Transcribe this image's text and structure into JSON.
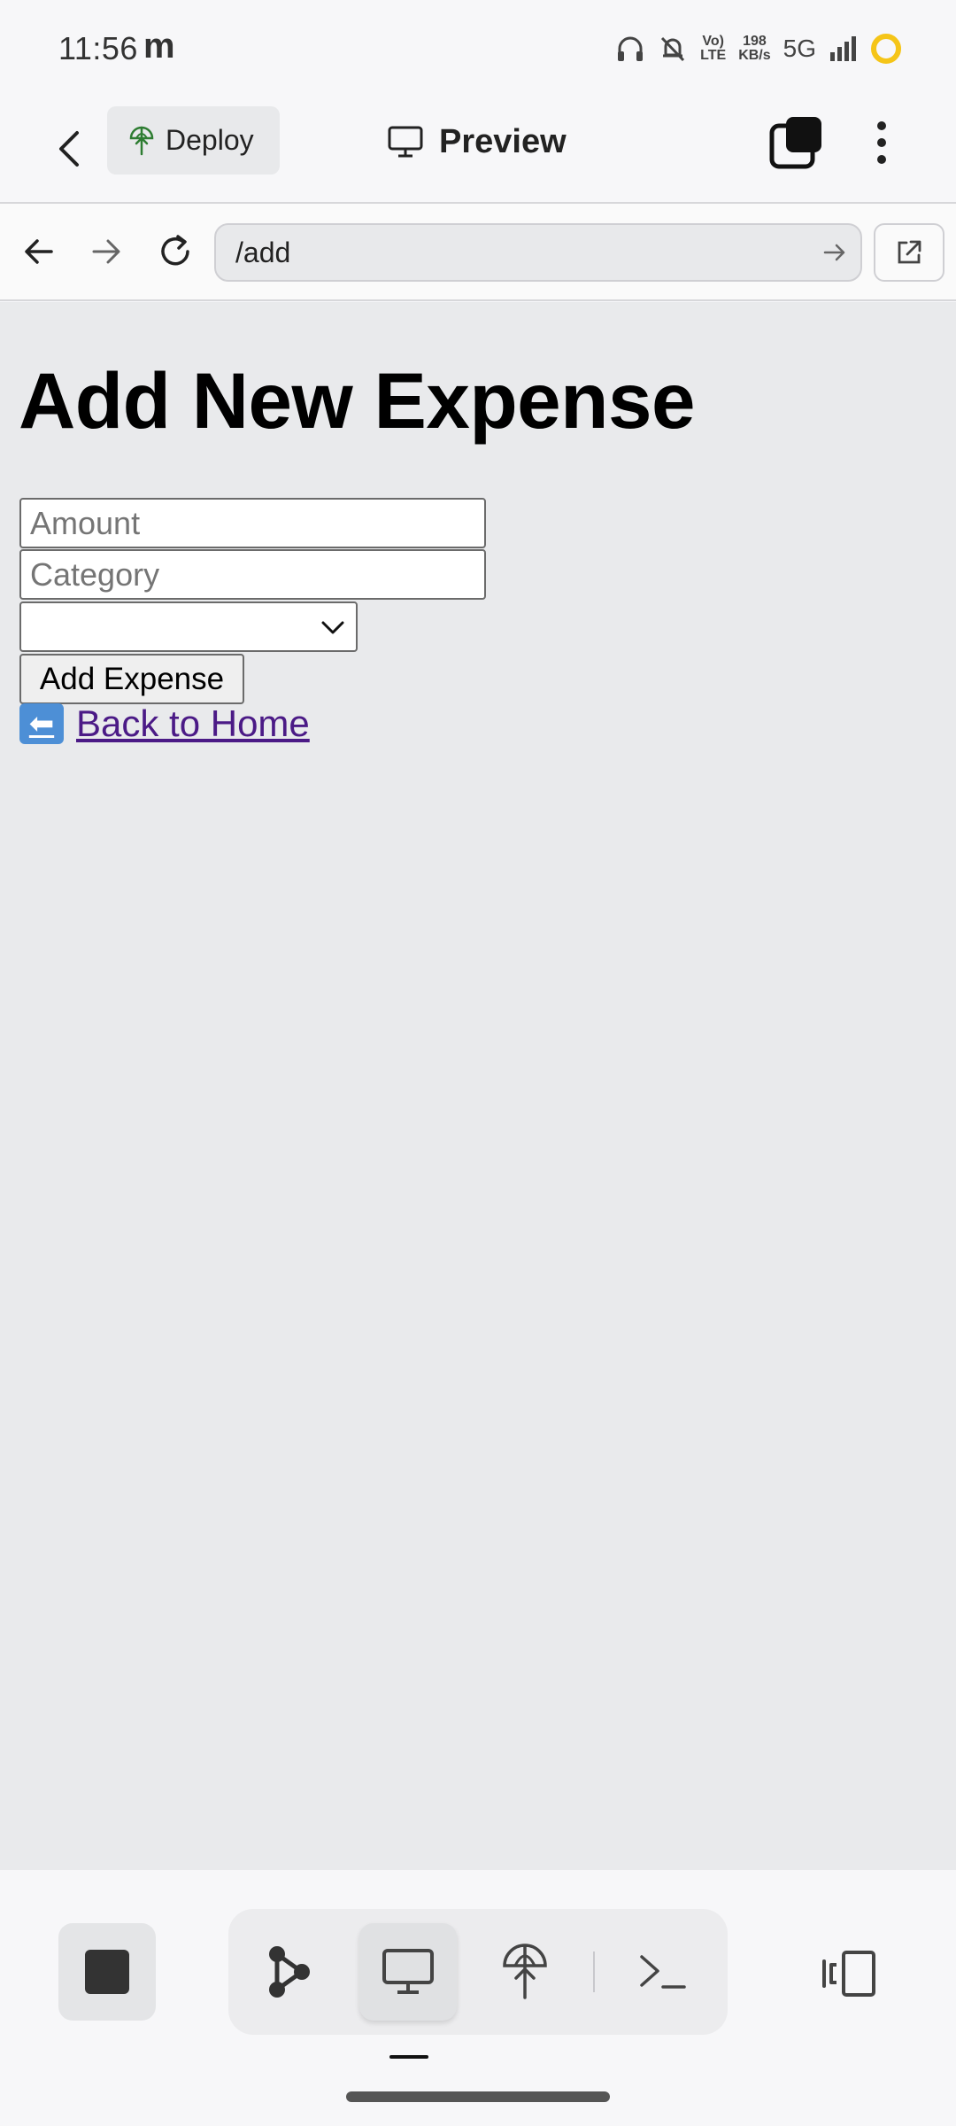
{
  "status_bar": {
    "time": "11:56",
    "carrier_glyph": "m",
    "volte_top": "Vo)",
    "volte_bottom": "LTE",
    "speed_value": "198",
    "speed_unit": "KB/s",
    "network": "5G",
    "icons": [
      "headphones-icon",
      "bell-off-icon",
      "volte-icon",
      "signal-icon",
      "battery-ring-icon"
    ]
  },
  "app_bar": {
    "deploy_label": "Deploy",
    "preview_label": "Preview",
    "icons": [
      "back-arrow-icon",
      "deploy-icon",
      "monitor-icon",
      "windows-icon",
      "more-vert-icon"
    ]
  },
  "url_bar": {
    "url": "/add",
    "icons": [
      "nav-back-icon",
      "nav-forward-icon",
      "reload-icon",
      "go-arrow-icon",
      "open-external-icon"
    ]
  },
  "page": {
    "title": "Add New Expense",
    "amount_placeholder": "Amount",
    "category_placeholder": "Category",
    "select_value": "",
    "submit_label": "Add Expense",
    "back_link_emoji": "⬅",
    "back_link_label": "Back to Home"
  },
  "bottom_bar": {
    "icons": [
      "stop-icon",
      "graph-icon",
      "monitor-icon",
      "deploy-icon",
      "terminal-icon",
      "side-panel-icon"
    ]
  },
  "colors": {
    "link": "#4b1a86",
    "content_background": "#e9eaec",
    "status_ring": "#f5c518",
    "emoji_background": "#4d8fd6"
  }
}
